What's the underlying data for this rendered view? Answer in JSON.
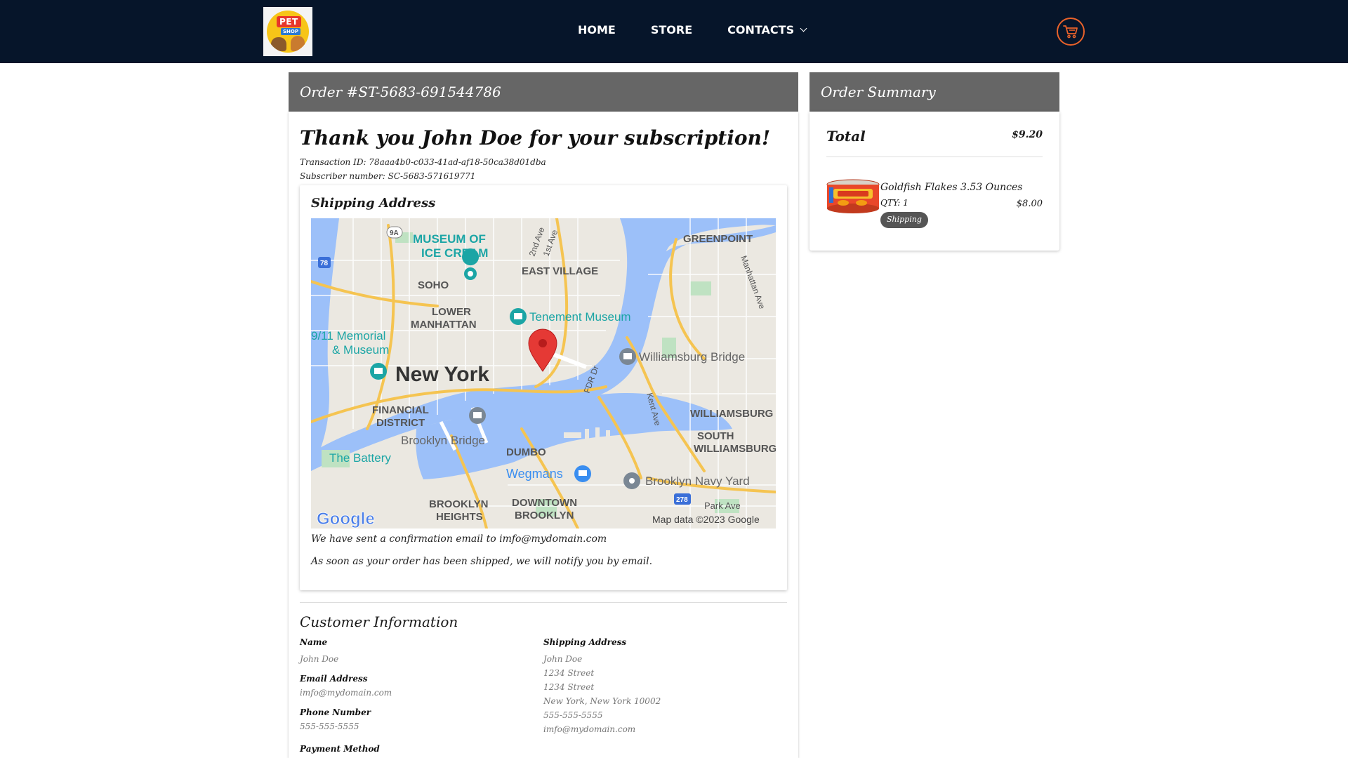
{
  "header": {
    "logo_text_top": "PET",
    "logo_text_bottom": "SHOP",
    "nav": [
      "HOME",
      "STORE",
      "CONTACTS"
    ]
  },
  "order": {
    "title": "Order #ST-5683-691544786",
    "thanks": "Thank you John Doe for your subscription!",
    "transaction": "Transaction ID: 78aaa4b0-c033-41ad-af18-50ca38d01dba",
    "subscriber": "Subscriber number: SC-5683-571619771"
  },
  "shipping_card": {
    "title": "Shipping Address",
    "note_email": "We have sent a confirmation email to imfo@mydomain.com",
    "note_ship": "As soon as your order has been shipped, we will notify you by email."
  },
  "map": {
    "labels": {
      "museum": "MUSEUM OF",
      "museum2": "ICE CREAM",
      "greenpoint": "GREENPOINT",
      "soho": "SOHO",
      "east_village": "EAST VILLAGE",
      "lower": "LOWER",
      "manhattan": "MANHATTAN",
      "tenement": "Tenement Museum",
      "memorial": "9/11 Memorial",
      "memorial2": "& Museum",
      "new_york": "New York",
      "williamsburg_bridge": "Williamsburg Bridge",
      "financial": "FINANCIAL",
      "district": "DISTRICT",
      "williamsburg": "WILLIAMSBURG",
      "brooklyn_bridge": "Brooklyn Bridge",
      "south": "SOUTH",
      "south_w": "WILLIAMSBURG",
      "dumbo": "DUMBO",
      "battery": "The Battery",
      "wegmans": "Wegmans",
      "navy_yard": "Brooklyn Navy Yard",
      "brooklyn_heights": "BROOKLYN",
      "heights": "HEIGHTS",
      "downtown": "DOWNTOWN",
      "downtown_b": "BROOKLYN",
      "park_ave": "Park Ave",
      "kent_ave": "Kent Ave",
      "fdr": "FDR Dr",
      "second_ave": "2nd Ave",
      "first_ave": "1st Ave",
      "manhattan_ave": "Manhattan Ave",
      "i78": "78",
      "r9a": "9A",
      "i278": "278",
      "google": "Google",
      "attribution": "Map data ©2023 Google"
    }
  },
  "customer": {
    "title": "Customer Information",
    "name_label": "Name",
    "name": "John Doe",
    "email_label": "Email Address",
    "email": "imfo@mydomain.com",
    "phone_label": "Phone Number",
    "phone": "555-555-5555",
    "payment_label": "Payment Method",
    "ship_label": "Shipping Address",
    "ship_lines": [
      "John Doe",
      "1234 Street",
      "1234 Street",
      "New York, New York 10002",
      "555-555-5555",
      "imfo@mydomain.com"
    ]
  },
  "summary": {
    "title": "Order Summary",
    "total_label": "Total",
    "total_value": "$9.20",
    "item": {
      "name": "Goldfish Flakes 3.53 Ounces",
      "qty": "QTY: 1",
      "badge": "Shipping",
      "price": "$8.00"
    }
  },
  "colors": {
    "header_bg": "#06152a",
    "panel_head": "#666666",
    "cart_accent": "#e9622a",
    "map_water": "#9cc0f9",
    "pin": "#e53935"
  },
  "icons": [
    "cart-icon",
    "chevron-down-icon",
    "map-pin-icon"
  ]
}
